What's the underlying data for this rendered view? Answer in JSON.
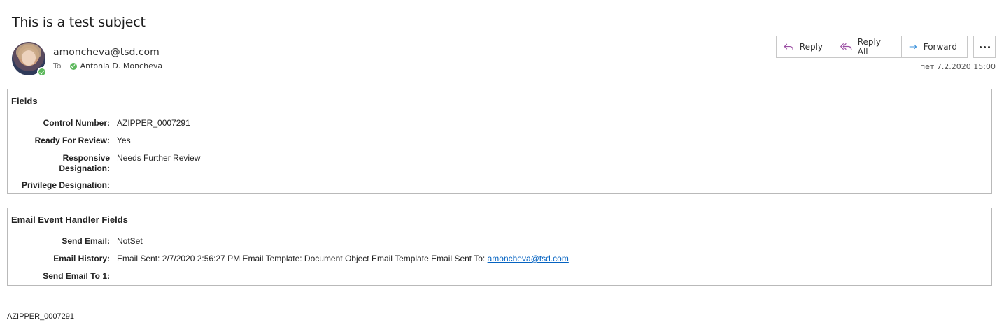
{
  "message": {
    "subject": "This is a test subject",
    "from": "amoncheva@tsd.com",
    "to_label": "To",
    "recipient": "Antonia D. Moncheva",
    "date": "пет 7.2.2020 15:00"
  },
  "actions": {
    "reply_label": "Reply",
    "reply_all_label": "Reply All",
    "forward_label": "Forward",
    "more_icon": "ellipsis-icon"
  },
  "fields_panel": {
    "title": "Fields",
    "rows": [
      {
        "label": "Control Number:",
        "value": "AZIPPER_0007291"
      },
      {
        "label": "Ready For Review:",
        "value": "Yes"
      },
      {
        "label": "Responsive Designation:",
        "value": "Needs Further Review"
      },
      {
        "label": "Privilege Designation:",
        "value": ""
      }
    ]
  },
  "event_panel": {
    "title": "Email Event Handler Fields",
    "rows": [
      {
        "label": "Send Email:",
        "value": "NotSet"
      },
      {
        "label": "Email History:",
        "value": "Email Sent: 2/7/2020 2:56:27 PM Email Template: Document Object Email Template Email Sent To: ",
        "link": "amoncheva@tsd.com"
      },
      {
        "label": "Send Email To 1:",
        "value": ""
      }
    ]
  },
  "footer": {
    "document_id": "AZIPPER_0007291"
  },
  "colors": {
    "presence_green": "#5cb85c",
    "reply_icon": "#9b4fa3",
    "forward_icon": "#2b88d8",
    "link": "#0563c1"
  }
}
